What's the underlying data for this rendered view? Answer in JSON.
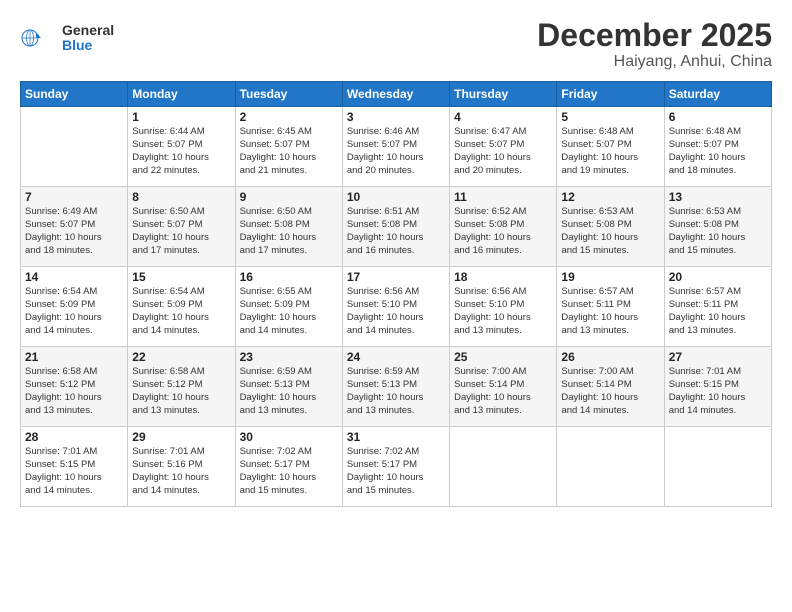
{
  "header": {
    "logo_line1": "General",
    "logo_line2": "Blue",
    "title": "December 2025",
    "subtitle": "Haiyang, Anhui, China"
  },
  "calendar": {
    "days_of_week": [
      "Sunday",
      "Monday",
      "Tuesday",
      "Wednesday",
      "Thursday",
      "Friday",
      "Saturday"
    ],
    "weeks": [
      [
        {
          "day": "",
          "info": ""
        },
        {
          "day": "1",
          "info": "Sunrise: 6:44 AM\nSunset: 5:07 PM\nDaylight: 10 hours\nand 22 minutes."
        },
        {
          "day": "2",
          "info": "Sunrise: 6:45 AM\nSunset: 5:07 PM\nDaylight: 10 hours\nand 21 minutes."
        },
        {
          "day": "3",
          "info": "Sunrise: 6:46 AM\nSunset: 5:07 PM\nDaylight: 10 hours\nand 20 minutes."
        },
        {
          "day": "4",
          "info": "Sunrise: 6:47 AM\nSunset: 5:07 PM\nDaylight: 10 hours\nand 20 minutes."
        },
        {
          "day": "5",
          "info": "Sunrise: 6:48 AM\nSunset: 5:07 PM\nDaylight: 10 hours\nand 19 minutes."
        },
        {
          "day": "6",
          "info": "Sunrise: 6:48 AM\nSunset: 5:07 PM\nDaylight: 10 hours\nand 18 minutes."
        }
      ],
      [
        {
          "day": "7",
          "info": "Sunrise: 6:49 AM\nSunset: 5:07 PM\nDaylight: 10 hours\nand 18 minutes."
        },
        {
          "day": "8",
          "info": "Sunrise: 6:50 AM\nSunset: 5:07 PM\nDaylight: 10 hours\nand 17 minutes."
        },
        {
          "day": "9",
          "info": "Sunrise: 6:50 AM\nSunset: 5:08 PM\nDaylight: 10 hours\nand 17 minutes."
        },
        {
          "day": "10",
          "info": "Sunrise: 6:51 AM\nSunset: 5:08 PM\nDaylight: 10 hours\nand 16 minutes."
        },
        {
          "day": "11",
          "info": "Sunrise: 6:52 AM\nSunset: 5:08 PM\nDaylight: 10 hours\nand 16 minutes."
        },
        {
          "day": "12",
          "info": "Sunrise: 6:53 AM\nSunset: 5:08 PM\nDaylight: 10 hours\nand 15 minutes."
        },
        {
          "day": "13",
          "info": "Sunrise: 6:53 AM\nSunset: 5:08 PM\nDaylight: 10 hours\nand 15 minutes."
        }
      ],
      [
        {
          "day": "14",
          "info": "Sunrise: 6:54 AM\nSunset: 5:09 PM\nDaylight: 10 hours\nand 14 minutes."
        },
        {
          "day": "15",
          "info": "Sunrise: 6:54 AM\nSunset: 5:09 PM\nDaylight: 10 hours\nand 14 minutes."
        },
        {
          "day": "16",
          "info": "Sunrise: 6:55 AM\nSunset: 5:09 PM\nDaylight: 10 hours\nand 14 minutes."
        },
        {
          "day": "17",
          "info": "Sunrise: 6:56 AM\nSunset: 5:10 PM\nDaylight: 10 hours\nand 14 minutes."
        },
        {
          "day": "18",
          "info": "Sunrise: 6:56 AM\nSunset: 5:10 PM\nDaylight: 10 hours\nand 13 minutes."
        },
        {
          "day": "19",
          "info": "Sunrise: 6:57 AM\nSunset: 5:11 PM\nDaylight: 10 hours\nand 13 minutes."
        },
        {
          "day": "20",
          "info": "Sunrise: 6:57 AM\nSunset: 5:11 PM\nDaylight: 10 hours\nand 13 minutes."
        }
      ],
      [
        {
          "day": "21",
          "info": "Sunrise: 6:58 AM\nSunset: 5:12 PM\nDaylight: 10 hours\nand 13 minutes."
        },
        {
          "day": "22",
          "info": "Sunrise: 6:58 AM\nSunset: 5:12 PM\nDaylight: 10 hours\nand 13 minutes."
        },
        {
          "day": "23",
          "info": "Sunrise: 6:59 AM\nSunset: 5:13 PM\nDaylight: 10 hours\nand 13 minutes."
        },
        {
          "day": "24",
          "info": "Sunrise: 6:59 AM\nSunset: 5:13 PM\nDaylight: 10 hours\nand 13 minutes."
        },
        {
          "day": "25",
          "info": "Sunrise: 7:00 AM\nSunset: 5:14 PM\nDaylight: 10 hours\nand 13 minutes."
        },
        {
          "day": "26",
          "info": "Sunrise: 7:00 AM\nSunset: 5:14 PM\nDaylight: 10 hours\nand 14 minutes."
        },
        {
          "day": "27",
          "info": "Sunrise: 7:01 AM\nSunset: 5:15 PM\nDaylight: 10 hours\nand 14 minutes."
        }
      ],
      [
        {
          "day": "28",
          "info": "Sunrise: 7:01 AM\nSunset: 5:15 PM\nDaylight: 10 hours\nand 14 minutes."
        },
        {
          "day": "29",
          "info": "Sunrise: 7:01 AM\nSunset: 5:16 PM\nDaylight: 10 hours\nand 14 minutes."
        },
        {
          "day": "30",
          "info": "Sunrise: 7:02 AM\nSunset: 5:17 PM\nDaylight: 10 hours\nand 15 minutes."
        },
        {
          "day": "31",
          "info": "Sunrise: 7:02 AM\nSunset: 5:17 PM\nDaylight: 10 hours\nand 15 minutes."
        },
        {
          "day": "",
          "info": ""
        },
        {
          "day": "",
          "info": ""
        },
        {
          "day": "",
          "info": ""
        }
      ]
    ]
  }
}
